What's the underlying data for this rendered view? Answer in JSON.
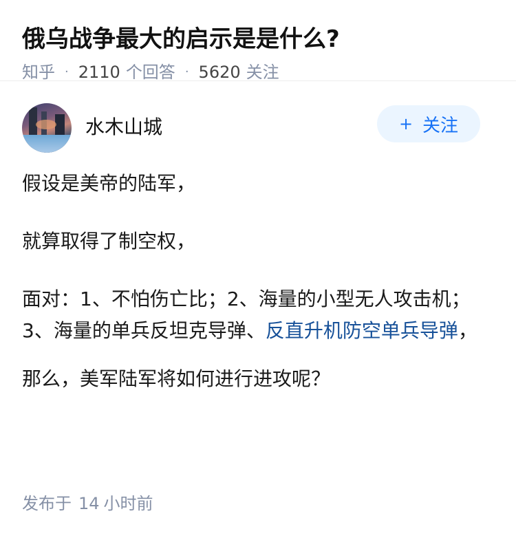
{
  "question": {
    "title": "俄乌战争最大的启示是是什么?",
    "source": "知乎",
    "answer_count": "2110",
    "answer_label": "个回答",
    "follow_count": "5620",
    "follow_label": "关注",
    "separator": "·"
  },
  "answer": {
    "author": {
      "name": "水木山城",
      "avatar_icon": "avatar-city-waterfront"
    },
    "follow_button": {
      "icon": "+",
      "label": "关注"
    },
    "paragraphs": {
      "p1": "假设是美帝的陆军，",
      "p2": "就算取得了制空权，",
      "p3_text": "面对：1、不怕伤亡比；2、海量的小型无人攻击机；3、海量的单兵反坦克导弹、",
      "p3_link": "反直升机防空单兵导弹",
      "p3_end": "，",
      "p4": "那么，美军陆军将如何进行进攻呢？"
    },
    "published": {
      "prefix": "发布于",
      "value": "14",
      "unit": "小时前"
    }
  },
  "colors": {
    "accent": "#1772f6",
    "link": "#175199",
    "meta": "#8590a6",
    "follow_bg": "#ebf5ff"
  }
}
